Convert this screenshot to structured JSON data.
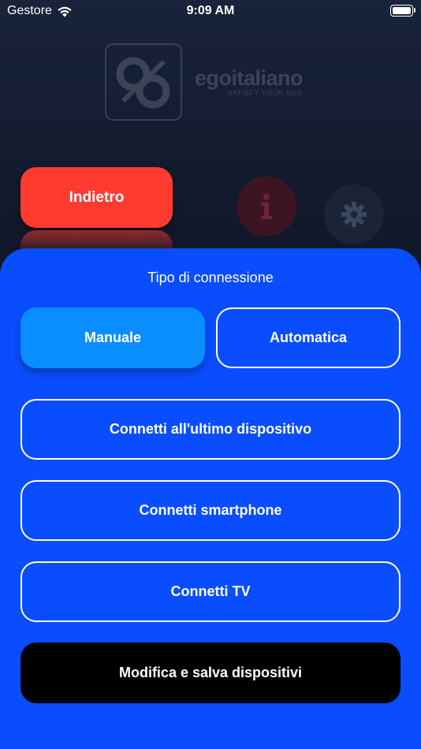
{
  "status_bar": {
    "carrier": "Gestore",
    "time": "9:09 AM"
  },
  "logo": {
    "name": "egoitaliano",
    "tagline": "SATISFY YOUR EGO"
  },
  "header": {
    "back_label": "Indietro"
  },
  "sheet": {
    "title": "Tipo di connessione",
    "mode_manual": "Manuale",
    "mode_auto": "Automatica",
    "selected_mode": "Manuale",
    "connect_last": "Connetti all'ultimo dispositivo",
    "connect_smartphone": "Connetti smartphone",
    "connect_tv": "Connetti TV",
    "edit_save": "Modifica e salva dispositivi"
  },
  "colors": {
    "sheet": "#0a4dff",
    "selected": "#0a8dff",
    "back": "#ff3b30"
  }
}
